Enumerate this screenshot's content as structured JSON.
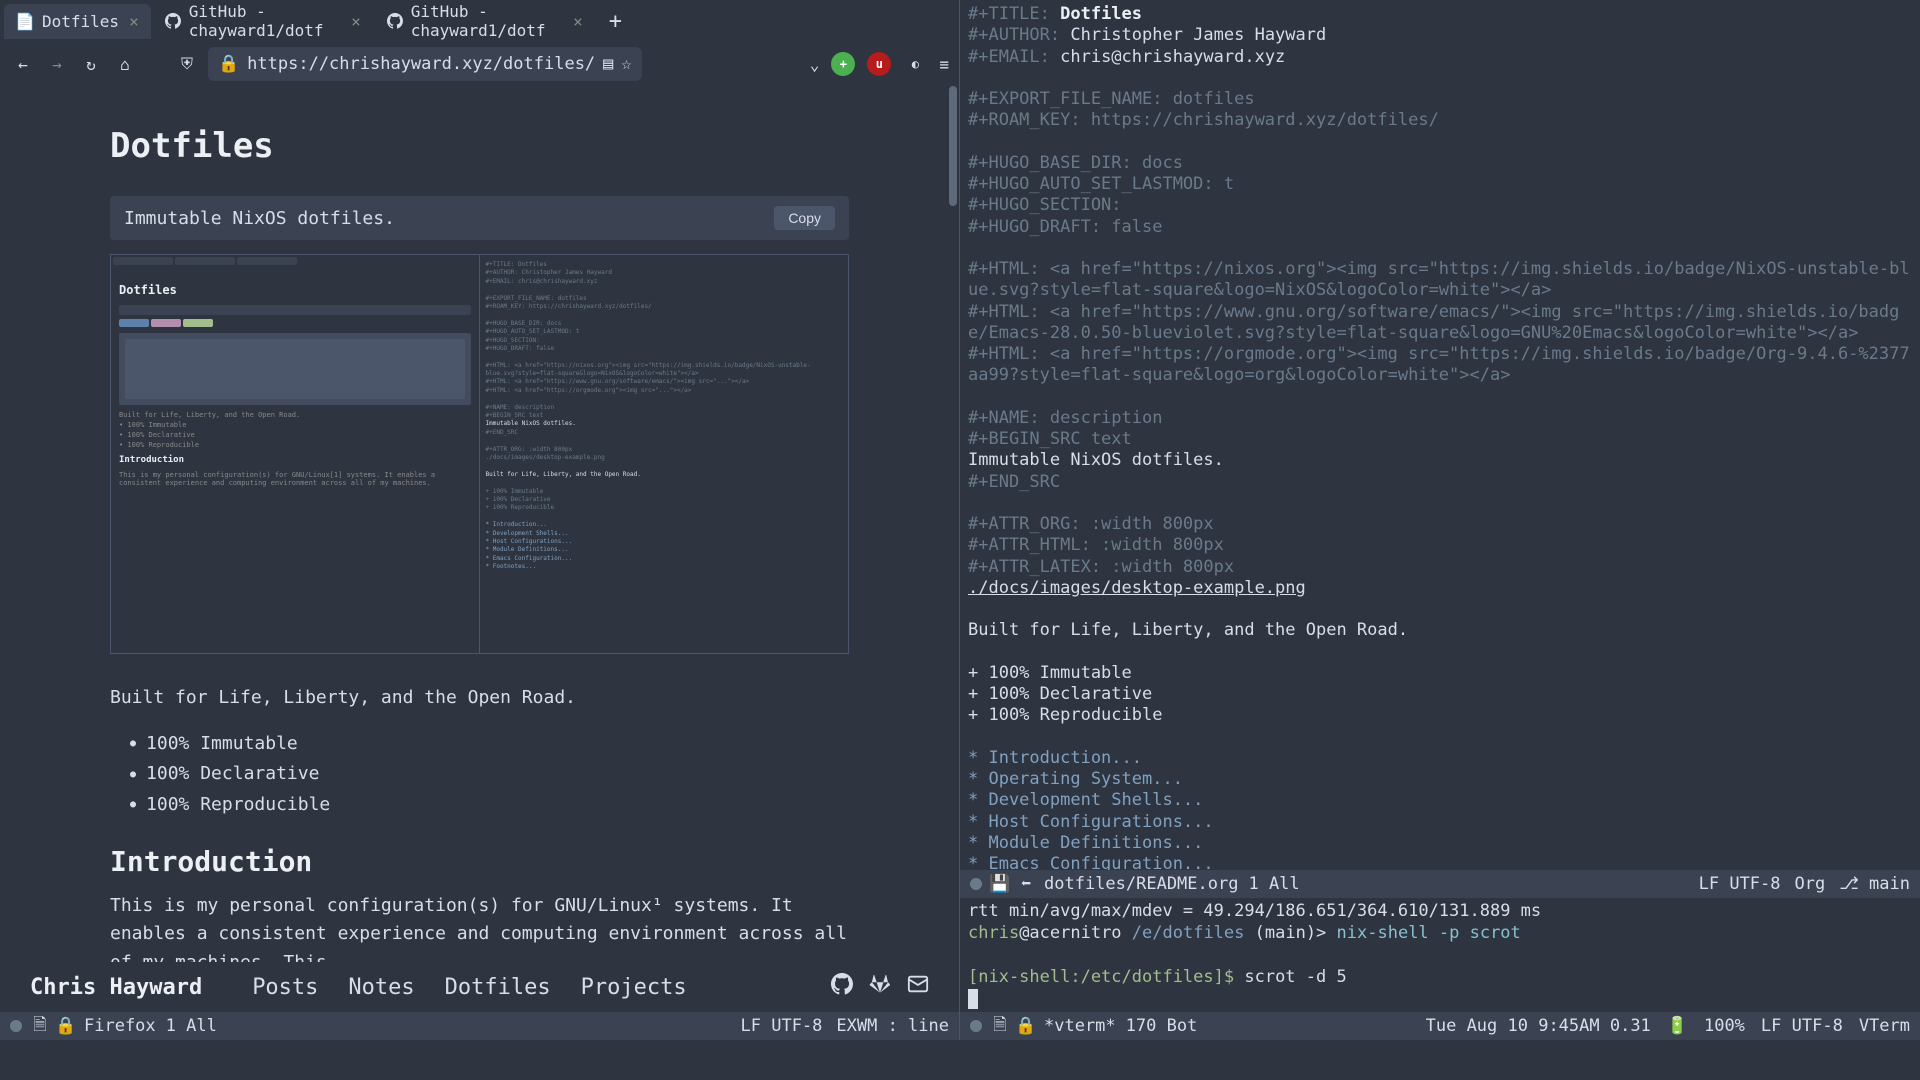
{
  "browser": {
    "tabs": [
      {
        "title": "Dotfiles",
        "active": true
      },
      {
        "title": "GitHub - chayward1/dotf",
        "active": false
      },
      {
        "title": "GitHub - chayward1/dotf",
        "active": false
      }
    ],
    "url": "https://chrishayward.xyz/dotfiles/",
    "nav": {
      "back": "‹",
      "forward": "›",
      "reload": "↻",
      "home": "⌂"
    },
    "toolbar_lock": "🔒",
    "shield": "⛨",
    "reader": "▤",
    "star": "☆",
    "pocket": "⌄",
    "menu": "≡"
  },
  "page": {
    "title": "Dotfiles",
    "desc": "Immutable NixOS dotfiles.",
    "copy": "Copy",
    "tagline": "Built for Life, Liberty, and the Open Road.",
    "bullets": [
      "100% Immutable",
      "100% Declarative",
      "100% Reproducible"
    ],
    "intro_h": "Introduction",
    "intro_p": "This is my personal configuration(s) for GNU/Linux¹ systems. It enables a consistent experience and computing environment across all of my machines. This"
  },
  "site_nav": {
    "brand": "Chris Hayward",
    "links": [
      "Posts",
      "Notes",
      "Dotfiles",
      "Projects"
    ]
  },
  "firefox_modeline": {
    "buffer": "Firefox",
    "pos": "1 All",
    "encoding": "LF UTF-8",
    "mode": "EXWM : line"
  },
  "editor": {
    "lines": [
      {
        "kw": "#+TITLE: ",
        "val": "Dotfiles",
        "cls": "org-title"
      },
      {
        "kw": "#+AUTHOR: ",
        "val": "Christopher James Hayward"
      },
      {
        "kw": "#+EMAIL: ",
        "val": "chris@chrishayward.xyz"
      },
      {
        "blank": true
      },
      {
        "kw": "#+EXPORT_FILE_NAME: dotfiles"
      },
      {
        "kw": "#+ROAM_KEY: https://chrishayward.xyz/dotfiles/"
      },
      {
        "blank": true
      },
      {
        "kw": "#+HUGO_BASE_DIR: docs"
      },
      {
        "kw": "#+HUGO_AUTO_SET_LASTMOD: t"
      },
      {
        "kw": "#+HUGO_SECTION:"
      },
      {
        "kw": "#+HUGO_DRAFT: false"
      },
      {
        "blank": true
      },
      {
        "kw": "#+HTML: <a href=\"https://nixos.org\"><img src=\"https://img.shields.io/badge/NixOS-unstable-blue.svg?style=flat-square&logo=NixOS&logoColor=white\"></a>"
      },
      {
        "kw": "#+HTML: <a href=\"https://www.gnu.org/software/emacs/\"><img src=\"https://img.shields.io/badge/Emacs-28.0.50-blueviolet.svg?style=flat-square&logo=GNU%20Emacs&logoColor=white\"></a>"
      },
      {
        "kw": "#+HTML: <a href=\"https://orgmode.org\"><img src=\"https://img.shields.io/badge/Org-9.4.6-%2377aa99?style=flat-square&logo=org&logoColor=white\"></a>"
      },
      {
        "blank": true
      },
      {
        "kw": "#+NAME: description"
      },
      {
        "kw": "#+BEGIN_SRC text"
      },
      {
        "val": "Immutable NixOS dotfiles."
      },
      {
        "kw": "#+END_SRC"
      },
      {
        "blank": true
      },
      {
        "kw": "#+ATTR_ORG: :width 800px"
      },
      {
        "kw": "#+ATTR_HTML: :width 800px"
      },
      {
        "kw": "#+ATTR_LATEX: :width 800px"
      },
      {
        "link": "./docs/images/desktop-example.png"
      },
      {
        "blank": true
      },
      {
        "val": "Built for Life, Liberty, and the Open Road."
      },
      {
        "blank": true
      },
      {
        "plus": "+ 100% Immutable"
      },
      {
        "plus": "+ 100% Declarative"
      },
      {
        "plus": "+ 100% Reproducible"
      },
      {
        "blank": true
      },
      {
        "head": "* Introduction..."
      },
      {
        "head": "* Operating System..."
      },
      {
        "head": "* Development Shells..."
      },
      {
        "head": "* Host Configurations..."
      },
      {
        "head": "* Module Definitions..."
      },
      {
        "head": "* Emacs Configuration..."
      }
    ]
  },
  "editor_modeline": {
    "buffer": "dotfiles/README.org",
    "pos": "1 All",
    "encoding": "LF UTF-8",
    "mode": "Org",
    "git": "⎇ main"
  },
  "terminal": {
    "ping": "rtt min/avg/max/mdev = 49.294/186.651/364.610/131.889 ms",
    "prompt1_user": "chris",
    "prompt1_at": "@acernitro",
    "prompt1_path": "/e/dotfiles",
    "prompt1_branch": "(main)>",
    "prompt1_cmd": "nix-shell -p scrot",
    "prompt2": "[nix-shell:/etc/dotfiles]$",
    "prompt2_cmd": "scrot -d 5"
  },
  "vterm_modeline": {
    "buffer": "*vterm*",
    "pos": "170 Bot",
    "datetime": "Tue Aug 10 9:45AM 0.31",
    "battery": "100%",
    "encoding": "LF UTF-8",
    "mode": "VTerm"
  }
}
